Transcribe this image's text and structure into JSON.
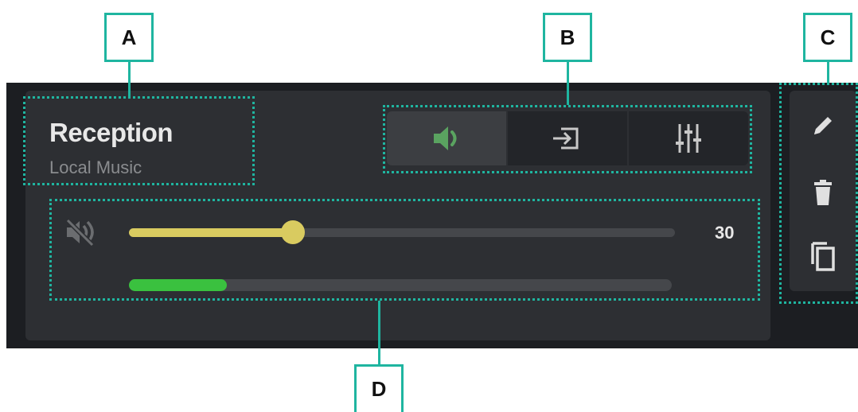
{
  "zone": {
    "name": "Reception",
    "source": "Local Music"
  },
  "modes": [
    {
      "icon": "volume-icon",
      "active": true
    },
    {
      "icon": "input-icon",
      "active": false
    },
    {
      "icon": "equalizer-icon",
      "active": false
    }
  ],
  "volume": {
    "mute_icon": "muted-speaker-icon",
    "value": 30,
    "display": "30",
    "fraction": 0.3
  },
  "meter": {
    "fraction": 0.18
  },
  "actions": [
    {
      "icon": "pencil-icon",
      "name": "edit"
    },
    {
      "icon": "trash-icon",
      "name": "delete"
    },
    {
      "icon": "copy-icon",
      "name": "duplicate"
    }
  ],
  "annotations": {
    "a": "A",
    "b": "B",
    "c": "C",
    "d": "D"
  },
  "colors": {
    "accent_green": "#5aa360",
    "volume_yellow": "#d9cb60",
    "meter_green": "#3ac13f",
    "callout_teal": "#1fb5a0",
    "card_bg": "#2d2f33"
  }
}
